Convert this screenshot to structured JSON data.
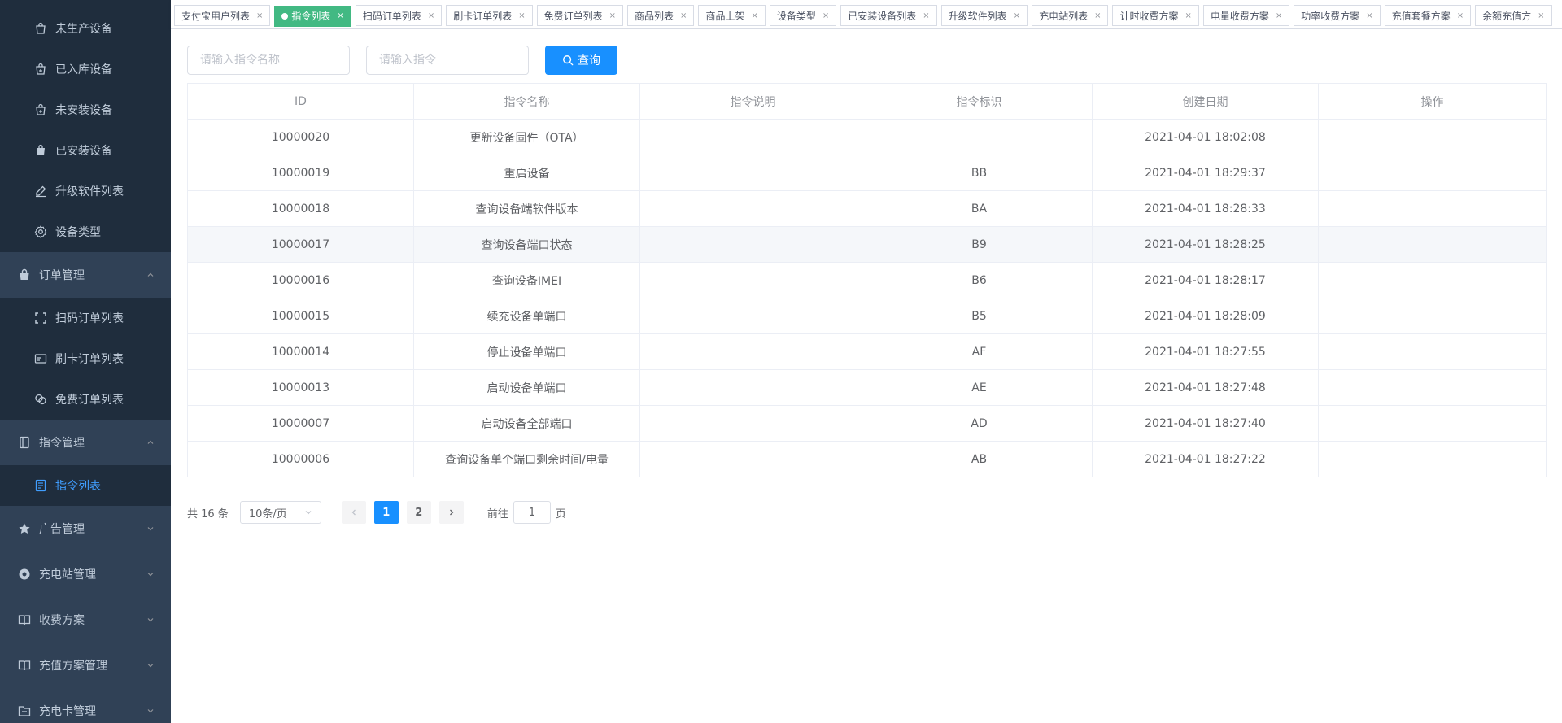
{
  "sidebar": {
    "items": [
      {
        "type": "sub",
        "label": "未生产设备",
        "icon": "shopping-bag-icon"
      },
      {
        "type": "sub",
        "label": "已入库设备",
        "icon": "shopping-bag-plus-icon"
      },
      {
        "type": "sub",
        "label": "未安装设备",
        "icon": "shopping-bag-plus-icon"
      },
      {
        "type": "sub",
        "label": "已安装设备",
        "icon": "shopping-bag-filled-icon"
      },
      {
        "type": "sub",
        "label": "升级软件列表",
        "icon": "edit-pen-icon"
      },
      {
        "type": "sub",
        "label": "设备类型",
        "icon": "gear-icon"
      },
      {
        "type": "group",
        "label": "订单管理",
        "icon": "bag-filled-icon",
        "expanded": true
      },
      {
        "type": "sub",
        "label": "扫码订单列表",
        "icon": "scan-frame-icon"
      },
      {
        "type": "sub",
        "label": "刷卡订单列表",
        "icon": "card-icon"
      },
      {
        "type": "sub",
        "label": "免费订单列表",
        "icon": "coins-icon"
      },
      {
        "type": "group",
        "label": "指令管理",
        "icon": "notebook-icon",
        "expanded": true
      },
      {
        "type": "sub",
        "label": "指令列表",
        "icon": "document-list-icon",
        "active": true
      },
      {
        "type": "group",
        "label": "广告管理",
        "icon": "star-icon",
        "expanded": false
      },
      {
        "type": "group",
        "label": "充电站管理",
        "icon": "circle-target-icon",
        "expanded": false
      },
      {
        "type": "group",
        "label": "收费方案",
        "icon": "open-book-icon",
        "expanded": false
      },
      {
        "type": "group",
        "label": "充值方案管理",
        "icon": "open-book-icon",
        "expanded": false
      },
      {
        "type": "group",
        "label": "充电卡管理",
        "icon": "folder-icon",
        "expanded": false
      }
    ]
  },
  "tags": [
    {
      "label": "支付宝用户列表",
      "active": false
    },
    {
      "label": "指令列表",
      "active": true
    },
    {
      "label": "扫码订单列表",
      "active": false
    },
    {
      "label": "刷卡订单列表",
      "active": false
    },
    {
      "label": "免费订单列表",
      "active": false
    },
    {
      "label": "商品列表",
      "active": false
    },
    {
      "label": "商品上架",
      "active": false
    },
    {
      "label": "设备类型",
      "active": false
    },
    {
      "label": "已安装设备列表",
      "active": false
    },
    {
      "label": "升级软件列表",
      "active": false
    },
    {
      "label": "充电站列表",
      "active": false
    },
    {
      "label": "计时收费方案",
      "active": false
    },
    {
      "label": "电量收费方案",
      "active": false
    },
    {
      "label": "功率收费方案",
      "active": false
    },
    {
      "label": "充值套餐方案",
      "active": false
    },
    {
      "label": "余额充值方",
      "active": false
    }
  ],
  "search": {
    "name_placeholder": "请输入指令名称",
    "cmd_placeholder": "请输入指令",
    "query_label": "查询"
  },
  "table": {
    "columns": [
      "ID",
      "指令名称",
      "指令说明",
      "指令标识",
      "创建日期",
      "操作"
    ],
    "rows": [
      [
        "10000020",
        "更新设备固件（OTA）",
        "",
        "",
        "2021-04-01 18:02:08",
        ""
      ],
      [
        "10000019",
        "重启设备",
        "",
        "BB",
        "2021-04-01 18:29:37",
        ""
      ],
      [
        "10000018",
        "查询设备端软件版本",
        "",
        "BA",
        "2021-04-01 18:28:33",
        ""
      ],
      [
        "10000017",
        "查询设备端口状态",
        "",
        "B9",
        "2021-04-01 18:28:25",
        ""
      ],
      [
        "10000016",
        "查询设备IMEI",
        "",
        "B6",
        "2021-04-01 18:28:17",
        ""
      ],
      [
        "10000015",
        "续充设备单端口",
        "",
        "B5",
        "2021-04-01 18:28:09",
        ""
      ],
      [
        "10000014",
        "停止设备单端口",
        "",
        "AF",
        "2021-04-01 18:27:55",
        ""
      ],
      [
        "10000013",
        "启动设备单端口",
        "",
        "AE",
        "2021-04-01 18:27:48",
        ""
      ],
      [
        "10000007",
        "启动设备全部端口",
        "",
        "AD",
        "2021-04-01 18:27:40",
        ""
      ],
      [
        "10000006",
        "查询设备单个端口剩余时间/电量",
        "",
        "AB",
        "2021-04-01 18:27:22",
        ""
      ]
    ],
    "hover_row": 3
  },
  "pagination": {
    "total_text": "共 16 条",
    "page_size": "10条/页",
    "pages": [
      "1",
      "2"
    ],
    "current": "1",
    "goto_prefix": "前往",
    "goto_value": "1",
    "goto_suffix": "页"
  }
}
